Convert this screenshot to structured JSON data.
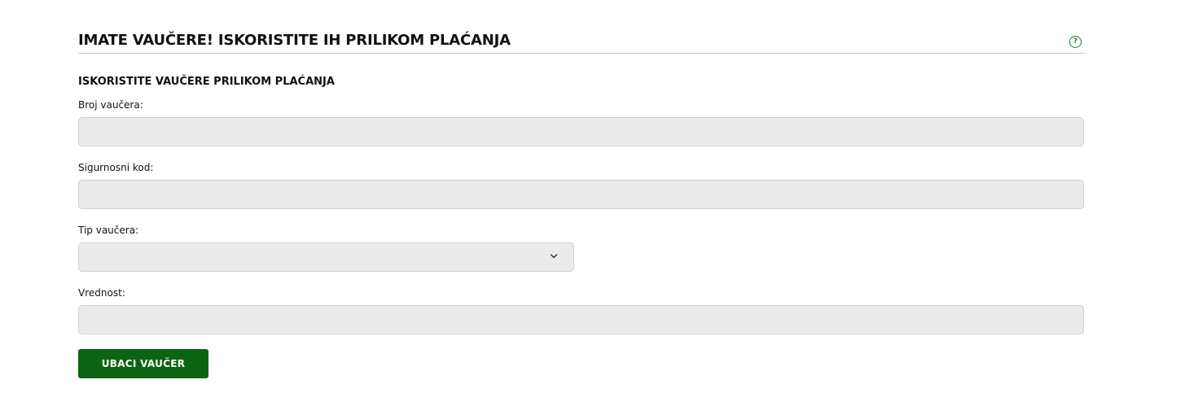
{
  "header": {
    "title": "IMATE VAUČERE! ISKORISTITE IH PRILIKOM PLAĆANJA",
    "help_icon_glyph": "?"
  },
  "section": {
    "title": "ISKORISTITE VAUČERE PRILIKOM PLAĆANJA"
  },
  "form": {
    "voucher_number": {
      "label": "Broj vaučera:",
      "value": ""
    },
    "security_code": {
      "label": "Sigurnosni kod:",
      "value": ""
    },
    "voucher_type": {
      "label": "Tip vaučera:",
      "selected": ""
    },
    "amount": {
      "label": "Vrednost:",
      "value": ""
    },
    "submit_label": "UBACI VAUČER"
  },
  "colors": {
    "accent": "#0b6413",
    "help_icon": "#1e7a34",
    "input_background": "#ebebeb"
  },
  "icons": {
    "help": "question-circle-icon",
    "select": "chevron-down-icon"
  }
}
